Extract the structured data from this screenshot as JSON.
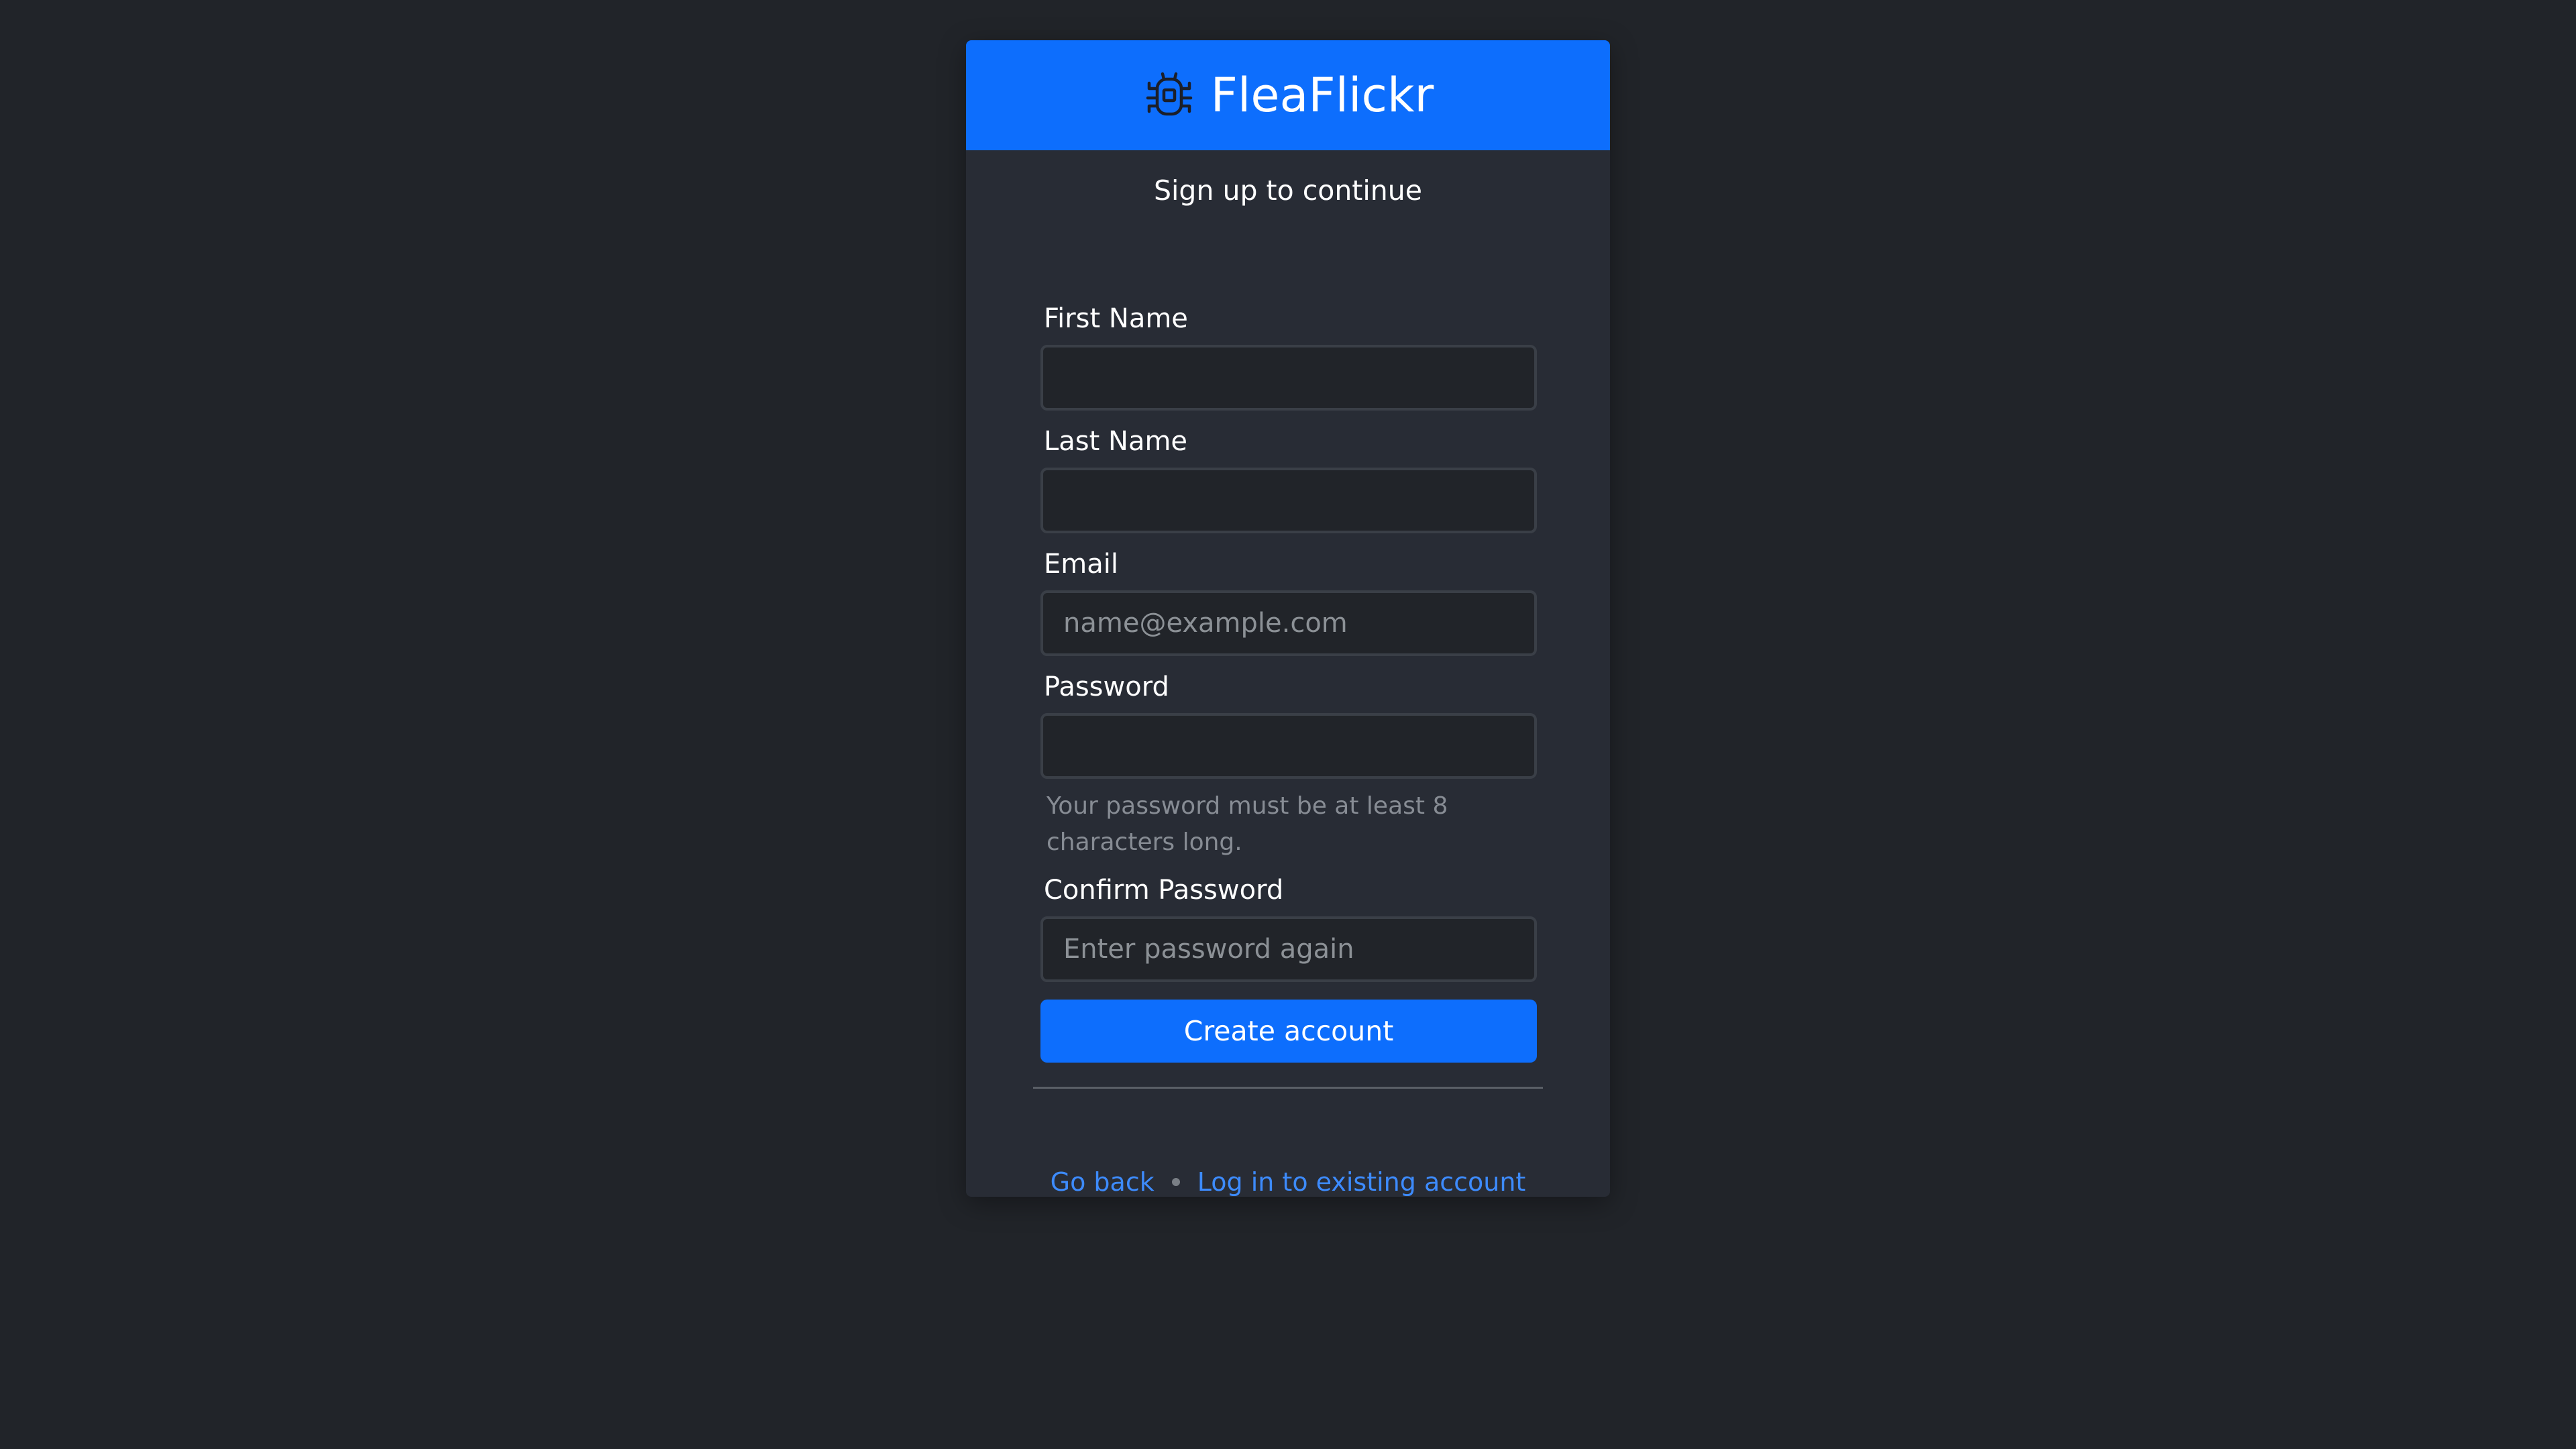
{
  "header": {
    "brand": "FleaFlickr",
    "logo_icon": "bug-icon",
    "background_color": "#0d6efd"
  },
  "subtitle": "Sign up to continue",
  "form": {
    "first_name": {
      "label": "First Name",
      "value": "",
      "placeholder": ""
    },
    "last_name": {
      "label": "Last Name",
      "value": "",
      "placeholder": ""
    },
    "email": {
      "label": "Email",
      "value": "",
      "placeholder": "name@example.com"
    },
    "password": {
      "label": "Password",
      "value": "",
      "placeholder": "",
      "hint": "Your password must be at least 8 characters long."
    },
    "confirm_password": {
      "label": "Confirm Password",
      "value": "",
      "placeholder": "Enter password again"
    },
    "submit_label": "Create account"
  },
  "footer": {
    "go_back": "Go back",
    "login": "Log in to existing account"
  }
}
